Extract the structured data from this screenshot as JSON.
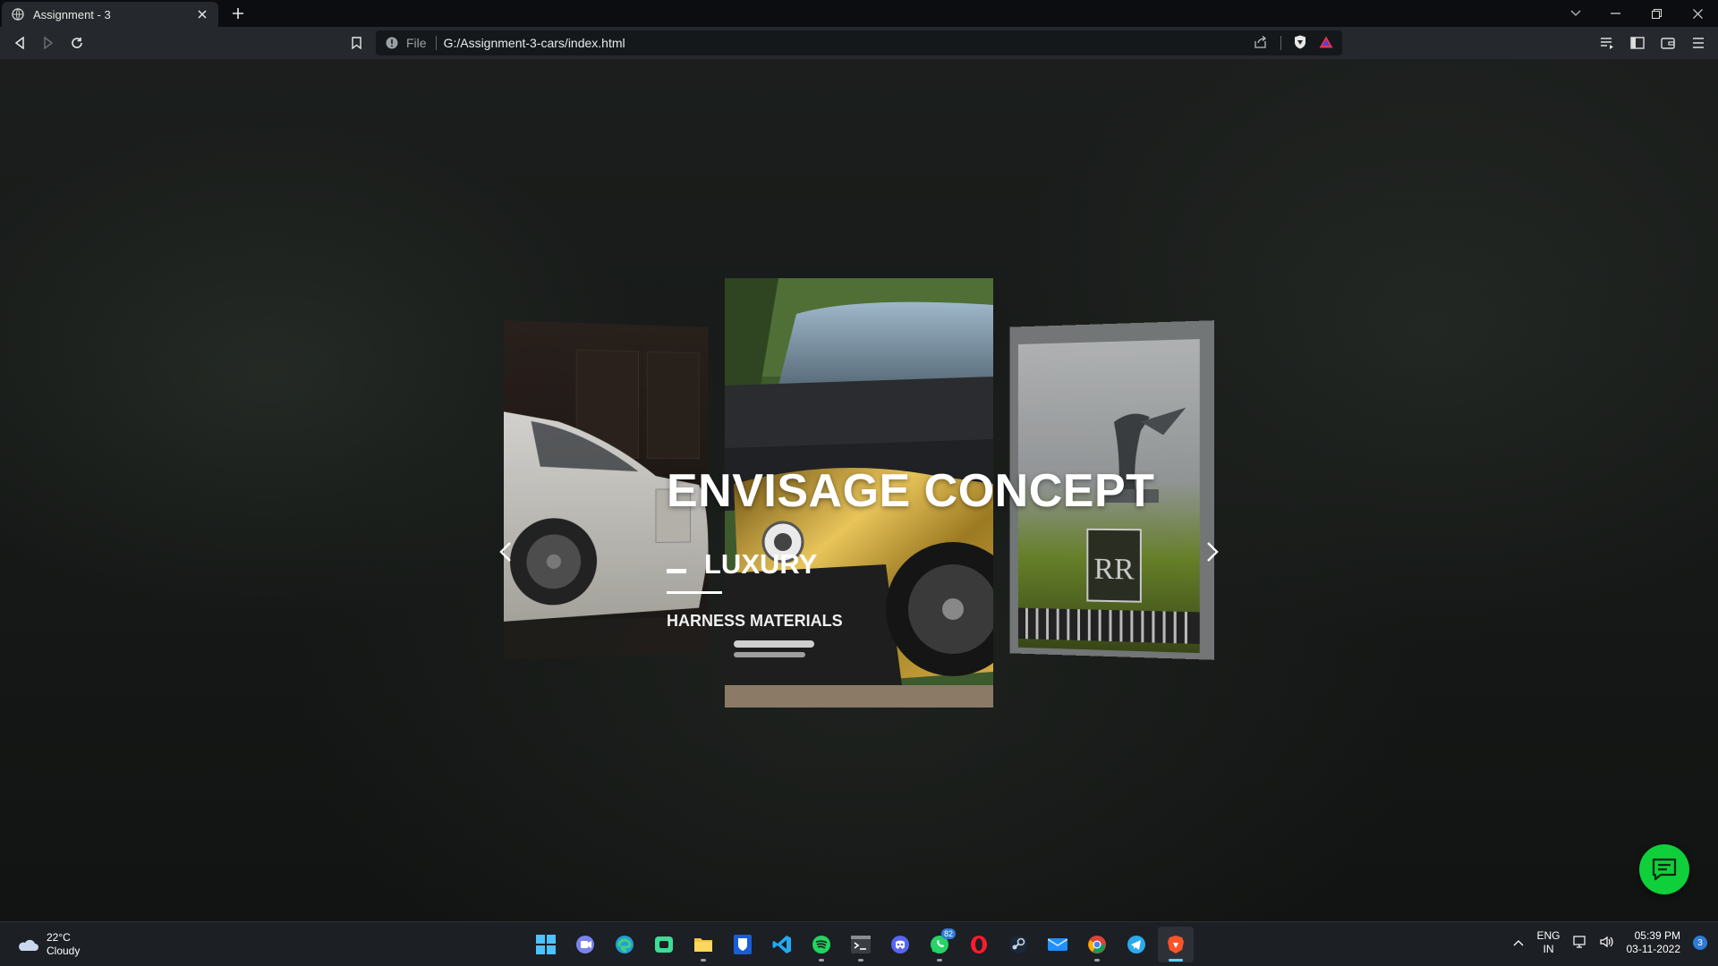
{
  "browser": {
    "tab": {
      "title": "Assignment - 3",
      "favicon": "globe-icon",
      "close_icon": "close-icon"
    },
    "new_tab_icon": "plus-icon",
    "window_controls": [
      "chevron-down-icon",
      "minimize-icon",
      "restore-icon",
      "close-icon"
    ],
    "url": {
      "scheme": "File",
      "path": "G:/Assignment-3-cars/index.html"
    }
  },
  "page": {
    "hero": {
      "title": "ENVISAGE CONCEPT",
      "subtitle": "LUXURY",
      "caption": "HARNESS MATERIALS"
    },
    "slides": [
      {
        "name": "white-rolls-royce",
        "description": "white car"
      },
      {
        "name": "gold-black-car",
        "description": "gold and black car"
      },
      {
        "name": "spirit-of-ecstasy",
        "description": "hood ornament"
      }
    ],
    "colors": {
      "chat_button": "#0fcf3a",
      "background": "#161917"
    }
  },
  "taskbar": {
    "weather": {
      "temp": "22°C",
      "condition": "Cloudy"
    },
    "apps": [
      {
        "icon": "windows-start-icon"
      },
      {
        "icon": "teams-icon"
      },
      {
        "icon": "edge-icon"
      },
      {
        "icon": "store-icon"
      },
      {
        "icon": "file-explorer-icon"
      },
      {
        "icon": "bitwarden-icon"
      },
      {
        "icon": "vscode-icon"
      },
      {
        "icon": "spotify-icon"
      },
      {
        "icon": "terminal-icon"
      },
      {
        "icon": "discord-icon"
      },
      {
        "icon": "whatsapp-icon",
        "badge": "82"
      },
      {
        "icon": "opera-icon"
      },
      {
        "icon": "steam-icon"
      },
      {
        "icon": "mail-icon"
      },
      {
        "icon": "chrome-icon"
      },
      {
        "icon": "telegram-icon"
      },
      {
        "icon": "brave-icon"
      }
    ],
    "tray": {
      "lang_top": "ENG",
      "lang_bottom": "IN",
      "time": "05:39 PM",
      "date": "03-11-2022",
      "notifications": "3"
    }
  }
}
